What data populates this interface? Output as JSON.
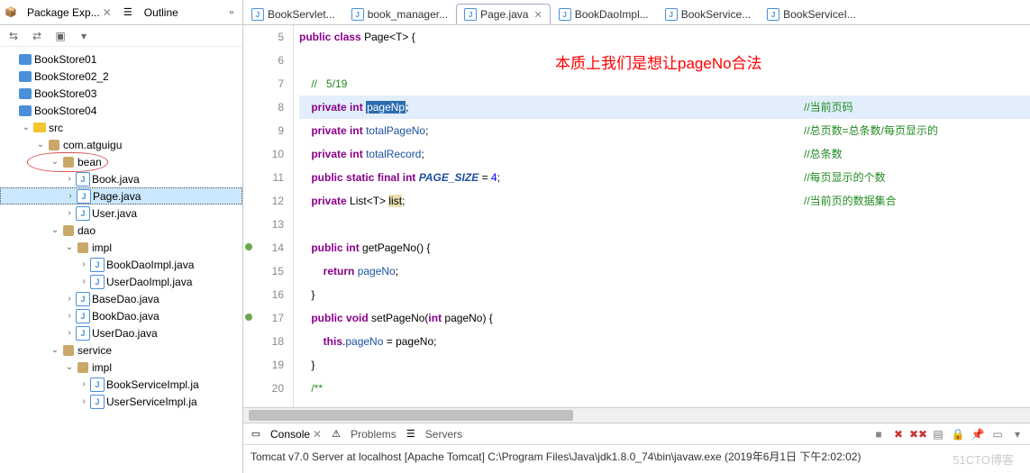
{
  "sidebar": {
    "tabs": {
      "pkg": "Package Exp...",
      "outline": "Outline"
    },
    "tree": [
      {
        "lvl": 0,
        "tw": "",
        "ico": "proj",
        "label": "BookStore01"
      },
      {
        "lvl": 0,
        "tw": "",
        "ico": "proj",
        "label": "BookStore02_2"
      },
      {
        "lvl": 0,
        "tw": "",
        "ico": "proj",
        "label": "BookStore03"
      },
      {
        "lvl": 0,
        "tw": "",
        "ico": "proj",
        "label": "BookStore04"
      },
      {
        "lvl": 1,
        "tw": "v",
        "ico": "fld",
        "label": "src"
      },
      {
        "lvl": 2,
        "tw": "v",
        "ico": "pkg",
        "label": "com.atguigu"
      },
      {
        "lvl": 3,
        "tw": "v",
        "ico": "pkg",
        "label": "bean",
        "circled": true
      },
      {
        "lvl": 4,
        "tw": ">",
        "ico": "java",
        "label": "Book.java"
      },
      {
        "lvl": 4,
        "tw": ">",
        "ico": "java",
        "label": "Page.java",
        "selected": true
      },
      {
        "lvl": 4,
        "tw": ">",
        "ico": "java",
        "label": "User.java"
      },
      {
        "lvl": 3,
        "tw": "v",
        "ico": "pkg",
        "label": "dao"
      },
      {
        "lvl": 4,
        "tw": "v",
        "ico": "pkg",
        "label": "impl"
      },
      {
        "lvl": 5,
        "tw": ">",
        "ico": "java",
        "label": "BookDaoImpl.java"
      },
      {
        "lvl": 5,
        "tw": ">",
        "ico": "java",
        "label": "UserDaoImpl.java"
      },
      {
        "lvl": 4,
        "tw": ">",
        "ico": "java",
        "label": "BaseDao.java"
      },
      {
        "lvl": 4,
        "tw": ">",
        "ico": "java",
        "label": "BookDao.java"
      },
      {
        "lvl": 4,
        "tw": ">",
        "ico": "java",
        "label": "UserDao.java"
      },
      {
        "lvl": 3,
        "tw": "v",
        "ico": "pkg",
        "label": "service"
      },
      {
        "lvl": 4,
        "tw": "v",
        "ico": "pkg",
        "label": "impl"
      },
      {
        "lvl": 5,
        "tw": ">",
        "ico": "java",
        "label": "BookServiceImpl.ja"
      },
      {
        "lvl": 5,
        "tw": ">",
        "ico": "java",
        "label": "UserServiceImpl.ja"
      }
    ]
  },
  "editor": {
    "tabs": [
      {
        "label": "BookServlet...",
        "active": false
      },
      {
        "label": "book_manager...",
        "active": false
      },
      {
        "label": "Page.java",
        "active": true
      },
      {
        "label": "BookDaoImpl...",
        "active": false
      },
      {
        "label": "BookService...",
        "active": false
      },
      {
        "label": "BookServiceI...",
        "active": false
      }
    ],
    "annotation": "本质上我们是想让pageNo合法",
    "lines": [
      {
        "n": 5,
        "t": "public class Page<T> {",
        "kind": "decl"
      },
      {
        "n": 6,
        "t": "",
        "kind": ""
      },
      {
        "n": 7,
        "t": "    //   5/19",
        "kind": "cm"
      },
      {
        "n": 8,
        "t": "    private int pageNo;",
        "kind": "f1",
        "rc": "//当前页码",
        "hl": true
      },
      {
        "n": 9,
        "t": "    private int totalPageNo;",
        "kind": "f",
        "rc": "//总页数=总条数/每页显示的"
      },
      {
        "n": 10,
        "t": "    private int totalRecord;",
        "kind": "f",
        "rc": "//总条数"
      },
      {
        "n": 11,
        "t": "    public static final int PAGE_SIZE = 4;",
        "kind": "c",
        "rc": "//每页显示的个数"
      },
      {
        "n": 12,
        "t": "    private List<T> list;",
        "kind": "l",
        "rc": "//当前页的数据集合"
      },
      {
        "n": 13,
        "t": "",
        "kind": ""
      },
      {
        "n": 14,
        "t": "    public int getPageNo() {",
        "kind": "m",
        "mark": true
      },
      {
        "n": 15,
        "t": "        return pageNo;",
        "kind": "r"
      },
      {
        "n": 16,
        "t": "    }",
        "kind": ""
      },
      {
        "n": 17,
        "t": "    public void setPageNo(int pageNo) {",
        "kind": "m2",
        "mark": true
      },
      {
        "n": 18,
        "t": "        this.pageNo = pageNo;",
        "kind": "s"
      },
      {
        "n": 19,
        "t": "    }",
        "kind": ""
      },
      {
        "n": 20,
        "t": "    /**",
        "kind": "cm2"
      }
    ]
  },
  "console": {
    "tabs": [
      "Console",
      "Problems",
      "Servers"
    ],
    "text": "Tomcat v7.0 Server at localhost [Apache Tomcat] C:\\Program Files\\Java\\jdk1.8.0_74\\bin\\javaw.exe (2019年6月1日 下午2:02:02)"
  },
  "watermark": "51CTO博客"
}
